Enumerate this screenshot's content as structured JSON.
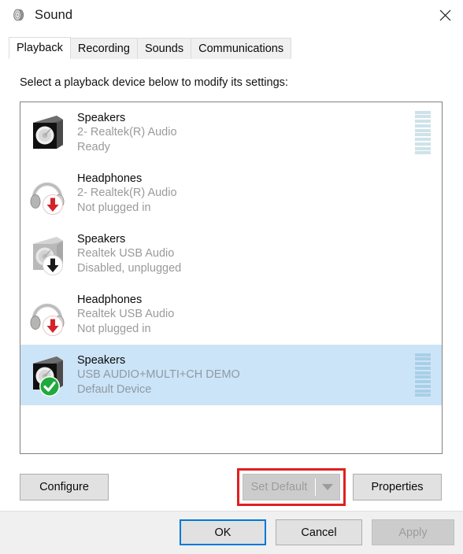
{
  "window": {
    "title": "Sound",
    "icon": "speaker-icon",
    "close_label": "✕"
  },
  "tabs": [
    {
      "label": "Playback",
      "active": true
    },
    {
      "label": "Recording",
      "active": false
    },
    {
      "label": "Sounds",
      "active": false
    },
    {
      "label": "Communications",
      "active": false
    }
  ],
  "playback": {
    "instruction": "Select a playback device below to modify its settings:",
    "devices": [
      {
        "name": "Speakers",
        "description": "2- Realtek(R) Audio",
        "status": "Ready",
        "icon": "speaker-icon",
        "badge": "none",
        "selected": false,
        "meter": true
      },
      {
        "name": "Headphones",
        "description": "2- Realtek(R) Audio",
        "status": "Not plugged in",
        "icon": "headphones-icon",
        "badge": "red-down-arrow-icon",
        "selected": false,
        "meter": false
      },
      {
        "name": "Speakers",
        "description": "Realtek USB Audio",
        "status": "Disabled, unplugged",
        "icon": "speaker-disabled-icon",
        "badge": "black-down-arrow-icon",
        "selected": false,
        "meter": false
      },
      {
        "name": "Headphones",
        "description": "Realtek USB Audio",
        "status": "Not plugged in",
        "icon": "headphones-icon",
        "badge": "red-down-arrow-icon",
        "selected": false,
        "meter": false
      },
      {
        "name": "Speakers",
        "description": "USB AUDIO+MULTI+CH DEMO",
        "status": "Default Device",
        "icon": "speaker-icon",
        "badge": "green-check-icon",
        "selected": true,
        "meter": true
      }
    ],
    "meter_segments": 10
  },
  "actions": {
    "configure": "Configure",
    "set_default": "Set Default",
    "set_default_dropdown": "set-default-dropdown-icon",
    "properties": "Properties"
  },
  "footer": {
    "ok": "OK",
    "cancel": "Cancel",
    "apply": "Apply"
  },
  "colors": {
    "selection": "#cce4f7",
    "annotation": "#e02020",
    "focus": "#0078d7",
    "meter_segment": "#cfe2ea",
    "green_check": "#1faa3c",
    "red_badge": "#d4232a"
  }
}
